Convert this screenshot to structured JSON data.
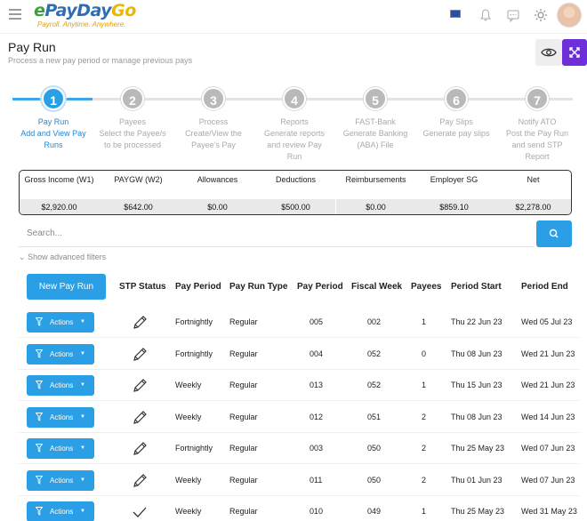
{
  "topbar": {
    "logo": {
      "e": "e",
      "pay": "Pay",
      "day": "Day",
      "go": "Go",
      "tagline": "Payroll. Anytime. Anywhere."
    },
    "icons": [
      "menu-icon",
      "flag-icon",
      "bell-icon",
      "chat-icon",
      "sun-icon",
      "avatar"
    ]
  },
  "header": {
    "title": "Pay Run",
    "subtitle": "Process a new pay period or manage previous pays"
  },
  "steps": [
    {
      "num": "1",
      "title": "Pay Run",
      "desc": "Add and View Pay Runs",
      "active": true
    },
    {
      "num": "2",
      "title": "Payees",
      "desc": "Select the Payee/s to be processed",
      "active": false
    },
    {
      "num": "3",
      "title": "Process",
      "desc": "Create/View the Payee's Pay",
      "active": false
    },
    {
      "num": "4",
      "title": "Reports",
      "desc": "Generate reports and review Pay Run",
      "active": false
    },
    {
      "num": "5",
      "title": "FAST-Bank",
      "desc": "Generate Banking (ABA) File",
      "active": false
    },
    {
      "num": "6",
      "title": "Pay Slips",
      "desc": "Generate pay slips",
      "active": false
    },
    {
      "num": "7",
      "title": "Notify ATO",
      "desc": "Post the Pay Run and send STP Report",
      "active": false
    }
  ],
  "summary": [
    {
      "label": "Gross Income (W1)",
      "value": "$2,920.00"
    },
    {
      "label": "PAYGW (W2)",
      "value": "$642.00"
    },
    {
      "label": "Allowances",
      "value": "$0.00"
    },
    {
      "label": "Deductions",
      "value": "$500.00"
    },
    {
      "label": "Reimbursements",
      "value": "$0.00"
    },
    {
      "label": "Employer SG",
      "value": "$859.10"
    },
    {
      "label": "Net",
      "value": "$2,278.00"
    }
  ],
  "search": {
    "placeholder": "Search..."
  },
  "advanced_filters": "Show advanced filters",
  "table": {
    "new_button": "New Pay Run",
    "headers": [
      "STP Status",
      "Pay Period",
      "Pay Run Type",
      "Pay Period",
      "Fiscal Week",
      "Payees",
      "Period Start",
      "Period End"
    ],
    "actions_label": "Actions",
    "rows": [
      {
        "status": "pencil",
        "period": "Fortnightly",
        "type": "Regular",
        "num": "005",
        "week": "002",
        "payees": "1",
        "start": "Thu 22 Jun 23",
        "end": "Wed 05 Jul 23"
      },
      {
        "status": "pencil",
        "period": "Fortnightly",
        "type": "Regular",
        "num": "004",
        "week": "052",
        "payees": "0",
        "start": "Thu 08 Jun 23",
        "end": "Wed 21 Jun 23"
      },
      {
        "status": "pencil",
        "period": "Weekly",
        "type": "Regular",
        "num": "013",
        "week": "052",
        "payees": "1",
        "start": "Thu 15 Jun 23",
        "end": "Wed 21 Jun 23"
      },
      {
        "status": "pencil",
        "period": "Weekly",
        "type": "Regular",
        "num": "012",
        "week": "051",
        "payees": "2",
        "start": "Thu 08 Jun 23",
        "end": "Wed 14 Jun 23"
      },
      {
        "status": "pencil",
        "period": "Fortnightly",
        "type": "Regular",
        "num": "003",
        "week": "050",
        "payees": "2",
        "start": "Thu 25 May 23",
        "end": "Wed 07 Jun 23"
      },
      {
        "status": "pencil",
        "period": "Weekly",
        "type": "Regular",
        "num": "011",
        "week": "050",
        "payees": "2",
        "start": "Thu 01 Jun 23",
        "end": "Wed 07 Jun 23"
      },
      {
        "status": "check",
        "period": "Weekly",
        "type": "Regular",
        "num": "010",
        "week": "049",
        "payees": "1",
        "start": "Thu 25 May 23",
        "end": "Wed 31 May 23"
      }
    ]
  },
  "colors": {
    "primary": "#2a9fe6",
    "expand_button": "#6f2fd8"
  }
}
